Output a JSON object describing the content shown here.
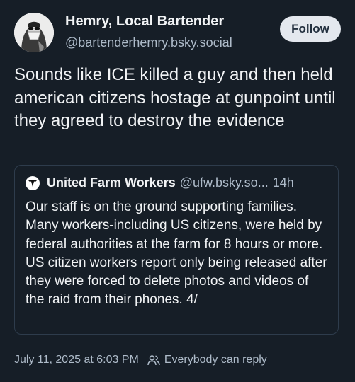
{
  "author": {
    "display_name": "Hemry, Local Bartender",
    "handle": "@bartenderhemry.bsky.social",
    "avatar_icon": "masked-person-avatar"
  },
  "follow_button": {
    "label": "Follow"
  },
  "post": {
    "text": "Sounds like ICE killed a guy and then held american citizens hostage at gunpoint until they agreed to destroy the evidence"
  },
  "quote": {
    "avatar_icon": "ufw-eagle-logo",
    "author_name": "United Farm Workers",
    "author_handle": "@ufw.bsky.so...",
    "time": "14h",
    "text": "Our staff is on the ground supporting families. Many workers-including US citizens, were held by federal authorities at the farm for 8 hours or more. US citizen workers report only being released after they were forced to delete photos and videos of the raid from their phones. 4/"
  },
  "meta": {
    "timestamp": "July 11, 2025 at 6:03 PM",
    "reply_setting_icon": "people-icon",
    "reply_setting": "Everybody can reply"
  },
  "colors": {
    "background": "#161e27",
    "text_primary": "#f1f3f5",
    "text_secondary": "#aebbc9",
    "border": "#2e3c4c",
    "button_bg": "#e4e8ee",
    "button_text": "#23303f"
  }
}
